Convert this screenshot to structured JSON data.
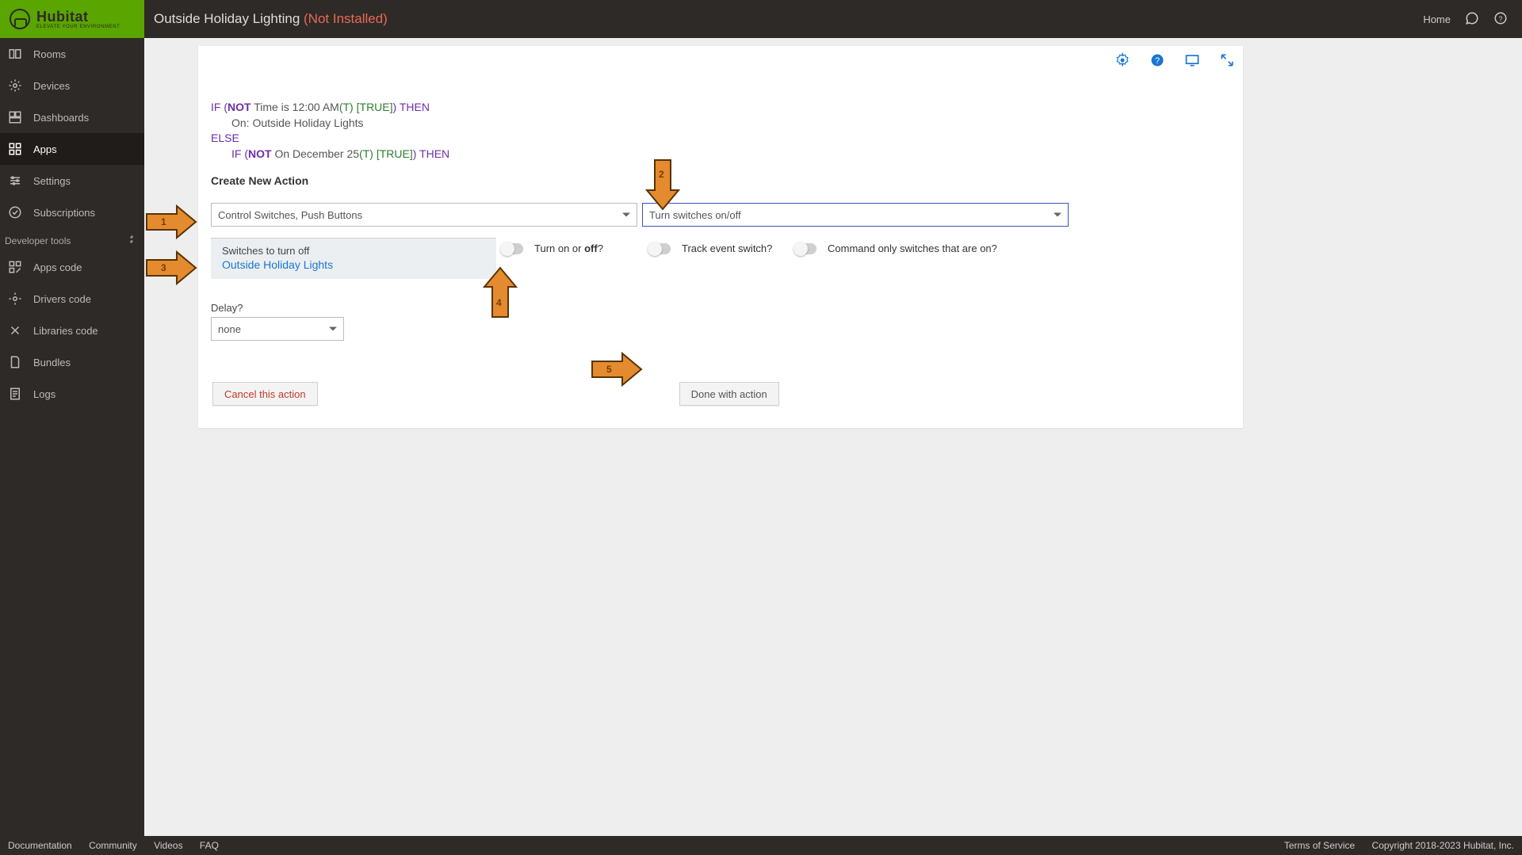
{
  "brand": {
    "name": "Hubitat",
    "tagline": "ELEVATE YOUR ENVIRONMENT"
  },
  "header": {
    "title": "Outside Holiday Lighting",
    "status": "(Not Installed)",
    "home": "Home"
  },
  "sidebar": {
    "items": [
      {
        "label": "Rooms",
        "icon": "rooms"
      },
      {
        "label": "Devices",
        "icon": "devices"
      },
      {
        "label": "Dashboards",
        "icon": "dashboards"
      },
      {
        "label": "Apps",
        "icon": "apps",
        "active": true
      },
      {
        "label": "Settings",
        "icon": "settings"
      },
      {
        "label": "Subscriptions",
        "icon": "subscriptions"
      }
    ],
    "dev_header": "Developer tools",
    "dev_items": [
      {
        "label": "Apps code",
        "icon": "appscode"
      },
      {
        "label": "Drivers code",
        "icon": "driverscode"
      },
      {
        "label": "Libraries code",
        "icon": "librariescode"
      },
      {
        "label": "Bundles",
        "icon": "bundles"
      },
      {
        "label": "Logs",
        "icon": "logs"
      }
    ]
  },
  "rule": {
    "l1_if": "IF (",
    "l1_not": "NOT",
    "l1_cond": " Time is 12:00 AM",
    "l1_t": "(T)",
    "l1_true": " [TRUE]",
    "l1_then": ") THEN",
    "l2": "On: Outside Holiday Lights",
    "l3": "ELSE",
    "l4_if": "IF (",
    "l4_not": "NOT",
    "l4_cond": " On December 25",
    "l4_t": "(T)",
    "l4_true": " [TRUE]",
    "l4_then": ") THEN"
  },
  "section_title": "Create New Action",
  "select_a": "Control Switches, Push Buttons",
  "select_b": "Turn switches on/off",
  "switches_card": {
    "label": "Switches to turn off",
    "value": "Outside Holiday Lights"
  },
  "toggles": {
    "turn_on_off_pre": "Turn on or ",
    "turn_on_off_bold": "off",
    "turn_on_off_suf": "?",
    "track": "Track event switch?",
    "cmd_only": "Command only switches that are on?"
  },
  "delay": {
    "label": "Delay?",
    "value": "none"
  },
  "buttons": {
    "cancel": "Cancel this action",
    "done": "Done with action"
  },
  "arrows": {
    "n1": "1",
    "n2": "2",
    "n3": "3",
    "n4": "4",
    "n5": "5"
  },
  "footer": {
    "left": [
      "Documentation",
      "Community",
      "Videos",
      "FAQ"
    ],
    "right": [
      "Terms of Service",
      "Copyright 2018-2023 Hubitat, Inc."
    ]
  }
}
